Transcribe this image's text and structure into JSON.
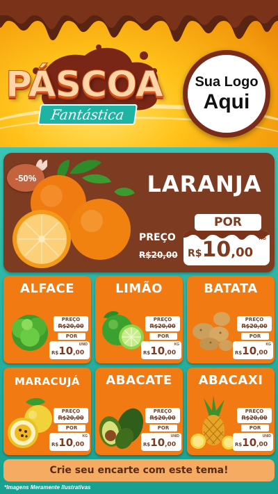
{
  "header": {
    "title": "PÁSCOA",
    "subtitle": "Fantástica",
    "logo_line1": "Sua Logo",
    "logo_line2": "Aqui"
  },
  "featured": {
    "discount": "-50%",
    "name": "LARANJA",
    "por_label": "POR",
    "preco_label": "PREÇO",
    "old_price": "R$20,00",
    "currency": "R$",
    "price_int": "10",
    "price_dec": ",00",
    "unit": "KG"
  },
  "products": [
    {
      "name": "ALFACE",
      "preco_label": "PREÇO",
      "old_price": "R$20,00",
      "por_label": "POR",
      "currency": "R$",
      "price_int": "10",
      "price_dec": ",00",
      "unit": "UNID"
    },
    {
      "name": "LIMÃO",
      "preco_label": "PREÇO",
      "old_price": "R$20,00",
      "por_label": "POR",
      "currency": "R$",
      "price_int": "10",
      "price_dec": ",00",
      "unit": "KG"
    },
    {
      "name": "BATATA",
      "preco_label": "PREÇO",
      "old_price": "R$20,00",
      "por_label": "POR",
      "currency": "R$",
      "price_int": "10",
      "price_dec": ",00",
      "unit": "KG"
    },
    {
      "name": "MARACUJÁ",
      "preco_label": "PREÇO",
      "old_price": "R$20,00",
      "por_label": "POR",
      "currency": "R$",
      "price_int": "10",
      "price_dec": ",00",
      "unit": "KG"
    },
    {
      "name": "ABACATE",
      "preco_label": "PREÇO",
      "old_price": "R$20,00",
      "por_label": "POR",
      "currency": "R$",
      "price_int": "10",
      "price_dec": ",00",
      "unit": "UNID"
    },
    {
      "name": "ABACAXI",
      "preco_label": "PREÇO",
      "old_price": "R$20,00",
      "por_label": "POR",
      "currency": "R$",
      "price_int": "10",
      "price_dec": ",00",
      "unit": "UNID"
    }
  ],
  "footer": {
    "cta": "Crie seu encarte com este tema!",
    "disclaimer": "*Imagens Meramente Ilustrativas"
  },
  "colors": {
    "chocolate": "#7d3b21",
    "orange_card": "#f17a12",
    "teal": "#1fa79c",
    "header_yellow": "#ffc21a"
  }
}
